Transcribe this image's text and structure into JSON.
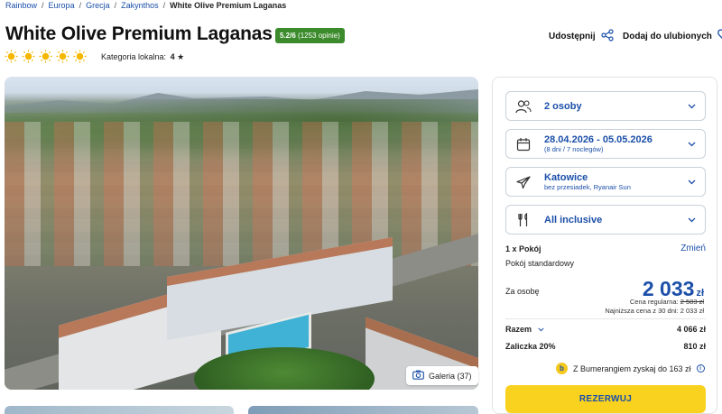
{
  "breadcrumb": [
    "Rainbow",
    "Europa",
    "Grecja",
    "Zakynthos",
    "White Olive Premium Laganas"
  ],
  "hotel": {
    "title": "White Olive Premium Laganas",
    "rating_score": "5.2/6",
    "rating_count": "(1253 opinie)",
    "suns": 5,
    "category_label": "Kategoria lokalna:",
    "category_value": "4",
    "category_star": "★"
  },
  "actions": {
    "share": "Udostępnij",
    "favorite": "Dodaj do ulubionych"
  },
  "gallery": {
    "label": "Galeria (37)"
  },
  "booking": {
    "guests": "2 osoby",
    "dates": "28.04.2026 - 05.05.2026",
    "dates_sub": "(8 dni / 7 noclegów)",
    "departure": "Katowice",
    "departure_sub": "bez przesiadek, Ryanair Sun",
    "board": "All inclusive",
    "room_count": "1 x Pokój",
    "room_change": "Zmień",
    "room_type": "Pokój standardowy",
    "per_person_label": "Za osobę",
    "price": "2 033",
    "currency": "zł",
    "regular_label": "Cena regularna:",
    "regular_price": "2 583 zł",
    "lowest_label": "Najniższa cena z 30 dni:",
    "lowest_price": "2 033 zł",
    "total_label": "Razem",
    "total_value": "4 066 zł",
    "deposit_label": "Zaliczka 20%",
    "deposit_value": "810 zł",
    "boomerang_icon": "b",
    "boomerang_text": "Z Bumerangiem zyskaj do 163 zł",
    "info_icon": "i",
    "book_label": "REZERWUJ"
  },
  "colors": {
    "brand_blue": "#1b4fa8",
    "rating_green": "#3b8a2b",
    "cta_yellow": "#f9d21f",
    "sun": "#f5b800"
  }
}
